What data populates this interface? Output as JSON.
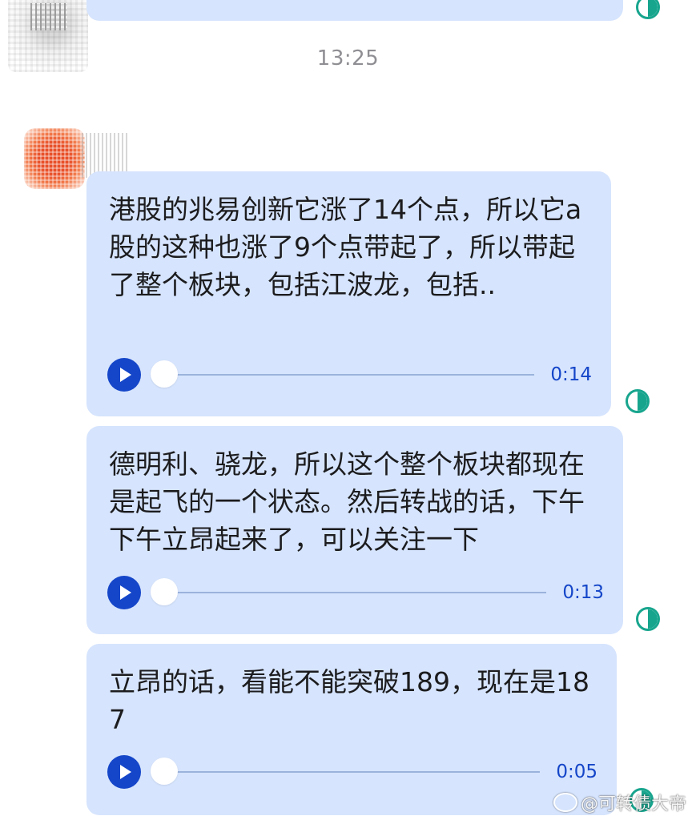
{
  "conversation": {
    "timestamp": "13:25",
    "messages": [
      {
        "text": "港股的兆易创新它涨了14个点，所以它a股的这种也涨了9个点带起了，所以带起了整个板块，包括江波龙，包括..",
        "duration": "0:14"
      },
      {
        "text": "德明利、骁龙，所以这个整个板块都现在是起飞的一个状态。然后转战的话，下午下午立昂起来了，可以关注一下",
        "duration": "0:13"
      },
      {
        "text": "立昂的话，看能不能突破189，现在是187",
        "duration": "0:05"
      }
    ]
  },
  "watermark": {
    "text": "@可转债大帝"
  },
  "icons": {
    "play": "play-icon",
    "read_status": "half-circle-icon",
    "weibo": "weibo-icon"
  },
  "colors": {
    "bubble": "#d6e4fd",
    "accent": "#1546c9",
    "status": "#18a58e",
    "timestamp": "#8e8e93"
  }
}
